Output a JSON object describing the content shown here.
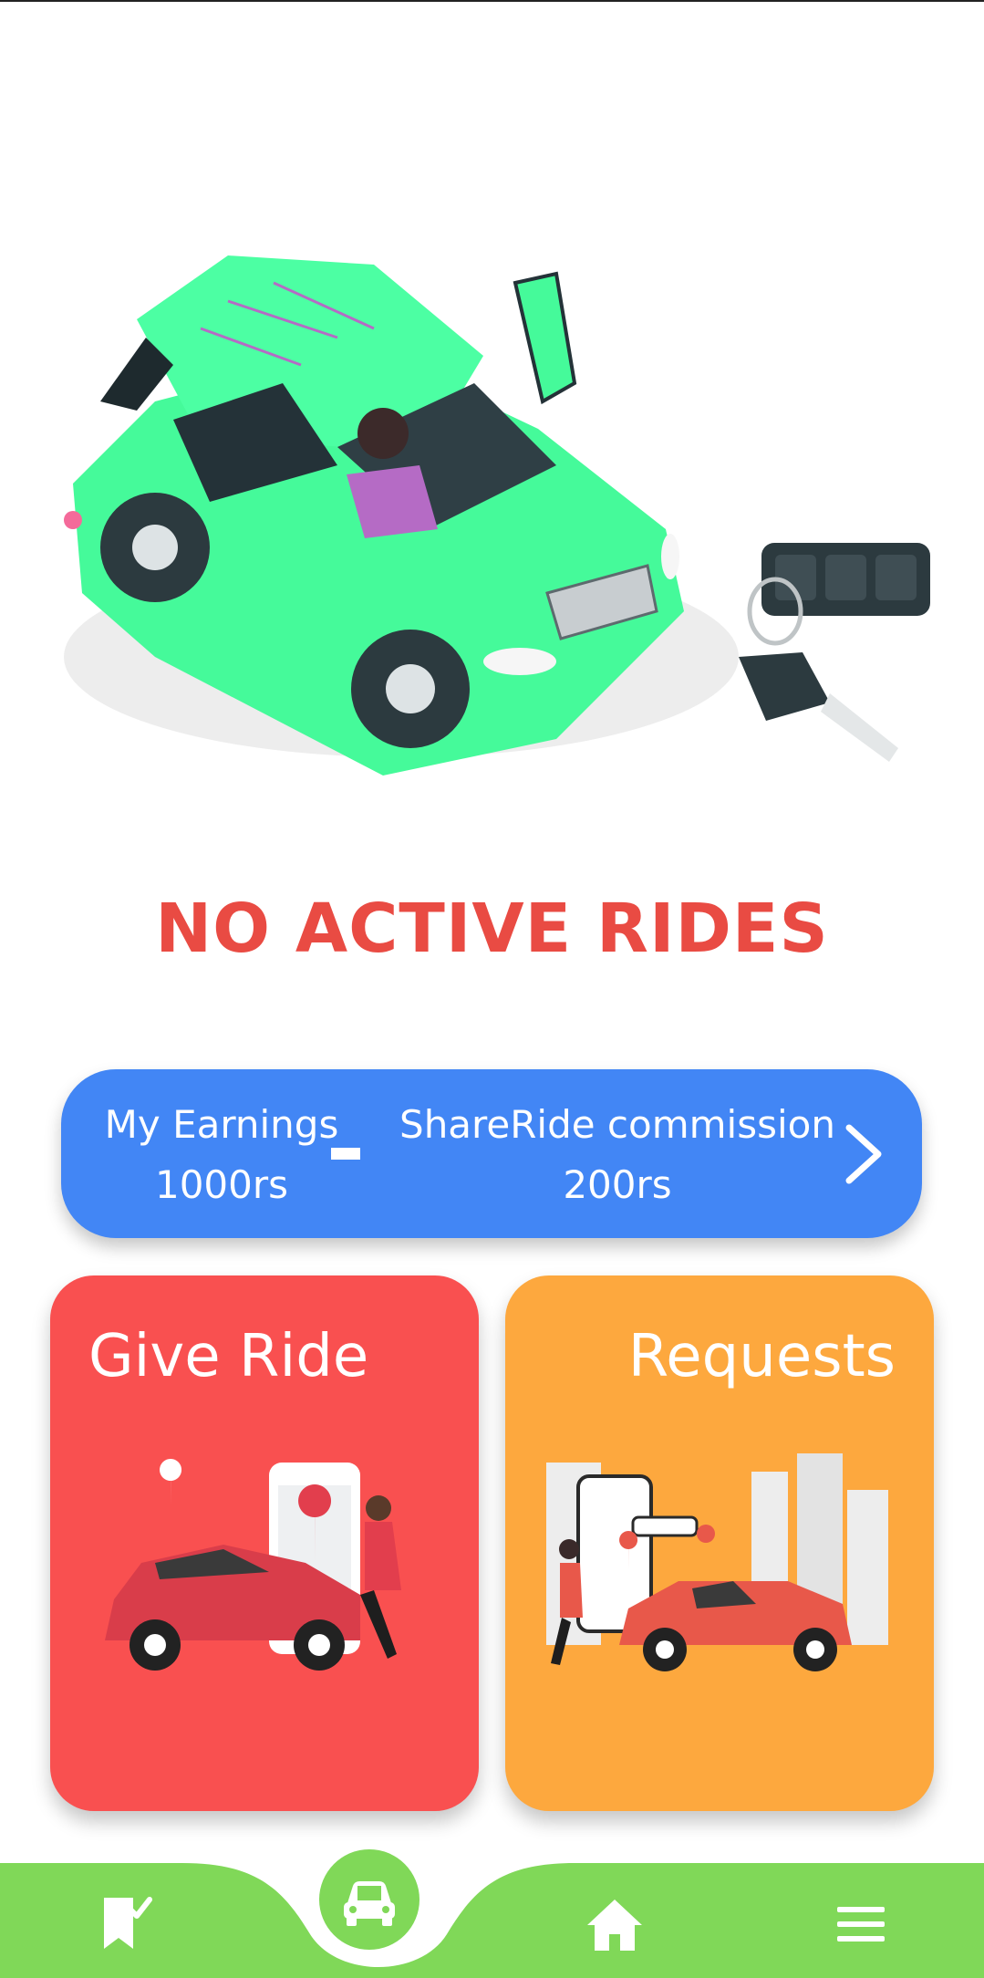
{
  "status": {
    "title": "NO ACTIVE RIDES",
    "color": "#E94B43"
  },
  "earnings": {
    "label": "My Earnings",
    "value": "1000rs",
    "commission_label": "ShareRide commission",
    "commission_value": "200rs",
    "background": "#4286F5",
    "chevron_icon": "chevron-right-icon"
  },
  "tiles": {
    "give_ride": {
      "title": "Give Ride",
      "background": "#F95050"
    },
    "requests": {
      "title": "Requests",
      "background": "#FDA83E"
    }
  },
  "nav": {
    "background": "#80D858",
    "items": [
      {
        "icon": "bookmark-check-icon"
      },
      {
        "icon": "car-icon"
      },
      {
        "icon": "home-icon"
      },
      {
        "icon": "menu-icon"
      }
    ]
  },
  "hero_colors": {
    "car_body": "#45FA9A",
    "shadow": "#E8E8E8"
  }
}
